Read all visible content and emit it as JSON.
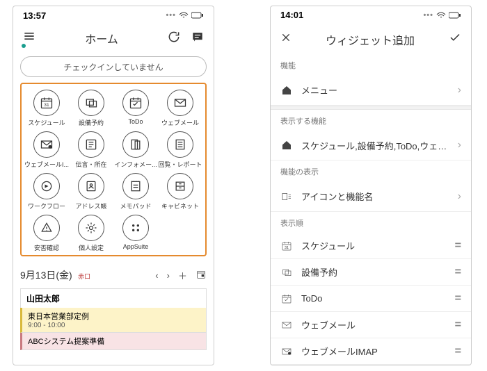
{
  "left": {
    "status_time": "13:57",
    "title": "ホーム",
    "checkin_label": "チェックインしていません",
    "apps": [
      {
        "label": "スケジュール",
        "icon": "calendar"
      },
      {
        "label": "設備予約",
        "icon": "equipment"
      },
      {
        "label": "ToDo",
        "icon": "todo"
      },
      {
        "label": "ウェブメール",
        "icon": "mail"
      },
      {
        "label": "ウェブメールI...",
        "icon": "mail2"
      },
      {
        "label": "伝言・所在",
        "icon": "message"
      },
      {
        "label": "インフォメー...",
        "icon": "info"
      },
      {
        "label": "回覧・レポート",
        "icon": "report"
      },
      {
        "label": "ワークフロー",
        "icon": "workflow"
      },
      {
        "label": "アドレス帳",
        "icon": "address"
      },
      {
        "label": "メモパッド",
        "icon": "memo"
      },
      {
        "label": "キャビネット",
        "icon": "cabinet"
      },
      {
        "label": "安否確認",
        "icon": "safety"
      },
      {
        "label": "個人設定",
        "icon": "settings"
      },
      {
        "label": "AppSuite",
        "icon": "appsuite"
      }
    ],
    "date_label": "9月13日(金)",
    "date_rokuyou": "赤口",
    "user_name": "山田太郎",
    "events": [
      {
        "title": "東日本営業部定例",
        "time": "9:00 - 10:00",
        "color": "yellow"
      },
      {
        "title": "ABCシステム提案準備",
        "time": "",
        "color": "pink"
      }
    ]
  },
  "right": {
    "status_time": "14:01",
    "title": "ウィジェット追加",
    "sec1_head": "機能",
    "menu_row_label": "メニュー",
    "sec2_head": "表示する機能",
    "features_row_label": "スケジュール,設備予約,ToDo,ウェブ…",
    "sec3_head": "機能の表示",
    "display_row_label": "アイコンと機能名",
    "sec4_head": "表示順",
    "order": [
      {
        "label": "スケジュール",
        "icon": "calendar"
      },
      {
        "label": "設備予約",
        "icon": "equipment"
      },
      {
        "label": "ToDo",
        "icon": "todo"
      },
      {
        "label": "ウェブメール",
        "icon": "mail"
      },
      {
        "label": "ウェブメールIMAP",
        "icon": "mail2"
      }
    ]
  }
}
